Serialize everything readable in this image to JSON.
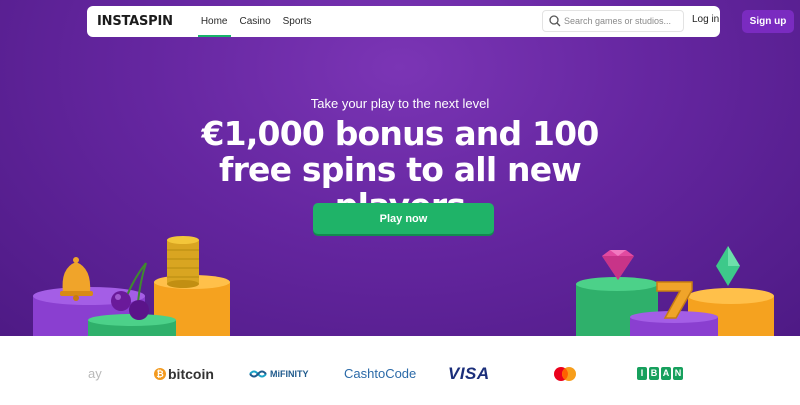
{
  "header": {
    "logo": "INSTASPIN",
    "nav": [
      {
        "label": "Home",
        "active": true
      },
      {
        "label": "Casino",
        "active": false
      },
      {
        "label": "Sports",
        "active": false
      }
    ],
    "search_placeholder": "Search games or studios...",
    "login_label": "Log in",
    "signup_label": "Sign up"
  },
  "hero": {
    "tagline": "Take your play to the next level",
    "headline": "€1,000 bonus and 100 free spins to all new players",
    "cta_label": "Play now"
  },
  "payments": {
    "paysafe": "ay",
    "bitcoin_symbol": "₿",
    "bitcoin": "bitcoin",
    "mifinity": "MiFINITY",
    "cashtocode": "CashtoCode",
    "visa": "VISA",
    "mastercard": "mastercard-logo",
    "iban": [
      "I",
      "B",
      "A",
      "N"
    ]
  },
  "colors": {
    "hero_bg": "#6a2aa3",
    "accent_green": "#1fb368",
    "signup_purple": "#7a2bc0"
  }
}
